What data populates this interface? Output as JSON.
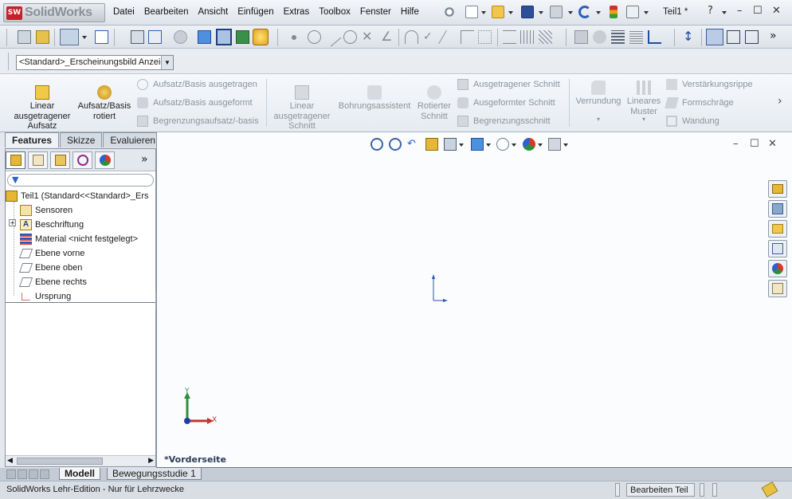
{
  "app": {
    "logo_badge": "SW",
    "name": "SolidWorks"
  },
  "menu": [
    "Datei",
    "Bearbeiten",
    "Ansicht",
    "Einfügen",
    "Extras",
    "Toolbox",
    "Fenster",
    "Hilfe"
  ],
  "document_title": "Teil1 *",
  "window_controls": {
    "help": "?",
    "minimize": "–",
    "restore": "☐",
    "close": "✕"
  },
  "appearance_select": {
    "value": "<Standard>_Erscheinungsbild Anzeig",
    "arrow": "▼"
  },
  "command_manager": {
    "big_buttons": [
      {
        "label": "Linear\nausgetragener\nAufsatz",
        "state": "enabled"
      },
      {
        "label": "Aufsatz/Basis\nrotiert",
        "state": "enabled"
      },
      {
        "label": "Linear\nausgetragener\nSchnitt",
        "state": "disabled"
      },
      {
        "label": "Bohrungsassistent",
        "state": "disabled"
      },
      {
        "label": "Rotierter\nSchnitt",
        "state": "disabled"
      },
      {
        "label": "Verrundung",
        "state": "disabled"
      },
      {
        "label": "Lineares\nMuster",
        "state": "disabled"
      }
    ],
    "small_buttons": [
      {
        "label": "Aufsatz/Basis ausgetragen"
      },
      {
        "label": "Aufsatz/Basis ausgeformt"
      },
      {
        "label": "Begrenzungsaufsatz/-basis"
      },
      {
        "label": "Ausgetragener Schnitt"
      },
      {
        "label": "Ausgeformter Schnitt"
      },
      {
        "label": "Begrenzungsschnitt"
      },
      {
        "label": "Verstärkungsrippe"
      },
      {
        "label": "Formschräge"
      },
      {
        "label": "Wandung"
      }
    ],
    "more": "›"
  },
  "panel_tabs": [
    {
      "label": "Features",
      "active": true
    },
    {
      "label": "Skizze",
      "active": false
    },
    {
      "label": "Evaluieren",
      "active": false
    }
  ],
  "tree": [
    {
      "label": "Teil1  (Standard<<Standard>_Ers",
      "icon": "part-icon",
      "expander": ""
    },
    {
      "label": "Sensoren",
      "icon": "sensor-icon",
      "expander": ""
    },
    {
      "label": "Beschriftung",
      "icon": "annotation-icon",
      "expander": "+"
    },
    {
      "label": "Material <nicht festgelegt>",
      "icon": "material-icon",
      "expander": ""
    },
    {
      "label": "Ebene vorne",
      "icon": "plane-icon",
      "expander": ""
    },
    {
      "label": "Ebene oben",
      "icon": "plane-icon",
      "expander": ""
    },
    {
      "label": "Ebene rechts",
      "icon": "plane-icon",
      "expander": ""
    },
    {
      "label": "Ursprung",
      "icon": "origin-icon",
      "expander": ""
    }
  ],
  "panel_more": "»",
  "viewport": {
    "view_label": "*Vorderseite",
    "triad": {
      "y": "Y",
      "x": "X"
    }
  },
  "bottom_tabs": [
    {
      "label": "Modell",
      "active": true
    },
    {
      "label": "Bewegungsstudie 1",
      "active": false
    }
  ],
  "status": {
    "left": "SolidWorks Lehr-Edition - Nur für Lehrzwecke",
    "mode": "Bearbeiten Teil"
  },
  "colors": {
    "accent_red": "#c8202a",
    "title_blue": "#2a3b55",
    "toolbar_bg": "#e4e8ee"
  }
}
